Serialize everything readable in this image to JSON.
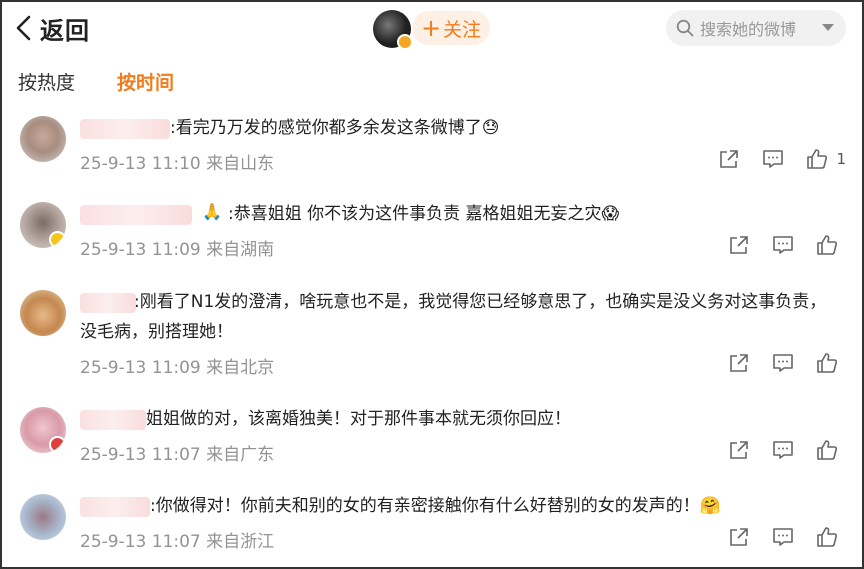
{
  "header": {
    "back_label": "返回",
    "follow_label": "关注",
    "search_placeholder": "搜索她的微博"
  },
  "sort_tabs": [
    {
      "label": "按热度",
      "active": false
    },
    {
      "label": "按时间",
      "active": true
    }
  ],
  "colors": {
    "accent": "#f27b1b",
    "meta_text": "#939393",
    "follow_bg": "#fff0e6"
  },
  "comments": [
    {
      "text": ":看完乃万发的感觉你都多余发这条微博了😓",
      "time": "25-9-13 11:10 来自山东",
      "likes": "1"
    },
    {
      "text": ":恭喜姐姐 你不该为这件事负责 嘉格姐姐无妄之灾😱",
      "prefix_emoji": "🙏",
      "time": "25-9-13 11:09 来自湖南",
      "likes": ""
    },
    {
      "text": ":刚看了N1发的澄清，啥玩意也不是，我觉得您已经够意思了，也确实是没义务对这事负责，没毛病，别搭理她！",
      "time": "25-9-13 11:09 来自北京",
      "likes": ""
    },
    {
      "text": "姐姐做的对，该离婚独美！对于那件事本就无须你回应！",
      "time": "25-9-13 11:07 来自广东",
      "likes": ""
    },
    {
      "text": ":你做得对！你前夫和别的女的有亲密接触你有什么好替别的女的发声的！🤗",
      "time": "25-9-13 11:07 来自浙江",
      "likes": ""
    }
  ],
  "icons": [
    "back-chevron-icon",
    "search-icon",
    "dropdown-caret-icon",
    "share-icon",
    "comment-icon",
    "like-icon"
  ]
}
